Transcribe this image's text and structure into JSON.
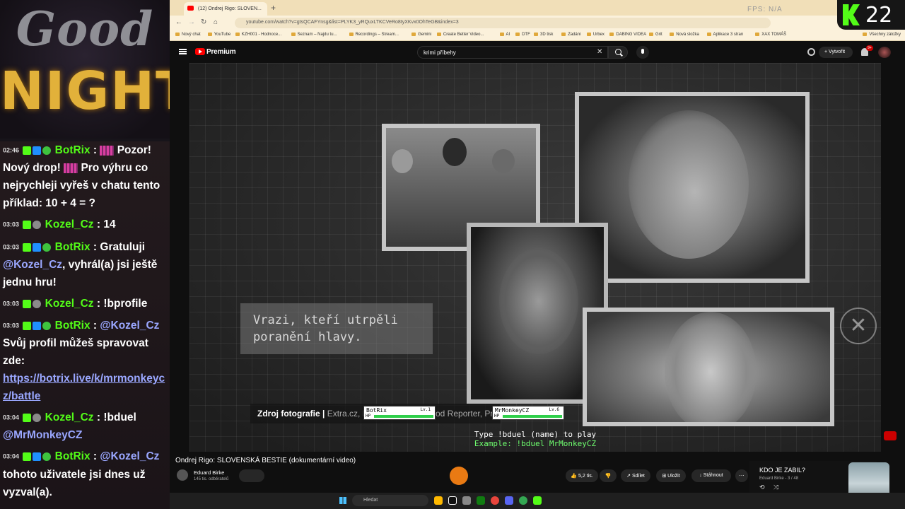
{
  "overlay": {
    "logo_line1": "Good",
    "logo_line2": "NIGHT",
    "kick_viewers": "22"
  },
  "chat": {
    "messages": [
      {
        "time": "02:46",
        "user": "BotRix",
        "pre": "Pozor!",
        "text": "Nový drop!",
        "text2": "Pro výhru co nejrychleji vyřeš v chatu tento příklad: 10 + 4 = ?"
      },
      {
        "time": "03:03",
        "user": "Kozel_Cz",
        "text": "14"
      },
      {
        "time": "03:03",
        "user": "BotRix",
        "text": "Gratuluji",
        "mention": "@Kozel_Cz",
        "text2": ", vyhrál(a) jsi ještě jednu hru!"
      },
      {
        "time": "03:03",
        "user": "Kozel_Cz",
        "text": "!bprofile"
      },
      {
        "time": "03:03",
        "user": "BotRix",
        "mention": "@Kozel_Cz",
        "text": "Svůj profil můžeš spravovat zde:",
        "link": "https://botrix.live/k/mrmonkeycz/battle"
      },
      {
        "time": "03:04",
        "user": "Kozel_Cz",
        "text": "!bduel",
        "mention": "@MrMonkeyCZ"
      },
      {
        "time": "03:04",
        "user": "BotRix",
        "mention": "@Kozel_Cz",
        "text": "tohoto uživatele jsi dnes už vyzval(a)."
      }
    ]
  },
  "browser": {
    "tab_title": "(12) Ondrej Rigo: SLOVEN...",
    "url": "youtube.com/watch?v=gtsQCAFYnsg&list=PLYK3_yRQuxLTKCVeRo8tyXKvx0OhTeGB&index=3",
    "fps_label": "FPS: N/A",
    "bookmarks": [
      "Nový chat",
      "YouTube",
      "KZH001 - Hodnoce...",
      "Seznam – Najdu tu...",
      "Recordings – Stream...",
      "Gemini",
      "Create Better Video...",
      "AI",
      "DTF",
      "3D tisk",
      "Zadáni",
      "Urbex",
      "DABING VIDEA",
      "Grit",
      "Nová složka",
      "Aplikace 3 stran",
      "XAX TOMÁŠ",
      "Všechny záložky"
    ]
  },
  "youtube": {
    "brand": "Premium",
    "search_query": "krimi příbehy",
    "create_label": "Vytvořit",
    "notifications": "9+",
    "video_title": "Ondrej Rigo: SLOVENSKÁ BESTIE (dokumentární video)",
    "channel_name": "Eduard Birke",
    "channel_subs": "145 tis. odběratelů",
    "likes": "5,2 tis.",
    "share_label": "Sdílet",
    "save_label": "Uložit",
    "download_label": "Stáhnout",
    "playlist_title": "KDO JE ZABIL?",
    "playlist_meta": "Eduard Birke - 3 / 48"
  },
  "video": {
    "caption": "Vrazi, kteří utrpěli poranění hlavy.",
    "credit_label": "Zdroj fotografie |",
    "credit_sources": "Extra.cz, Br",
    "credit_tail": "od Reporter, Pr",
    "duel_line1": "Type !bduel (name) to play",
    "duel_line2": "Example: !bduel MrMonkeyCZ",
    "player1": {
      "name": "BotRix",
      "level": "Lv.1",
      "hp_label": "HP",
      "hp_fraction": 1.0
    },
    "player2": {
      "name": "MrMonkeyCZ",
      "level": "Lv.6",
      "hp_label": "HP",
      "hp_fraction": 1.0
    }
  },
  "taskbar": {
    "search_placeholder": "Hledat"
  }
}
